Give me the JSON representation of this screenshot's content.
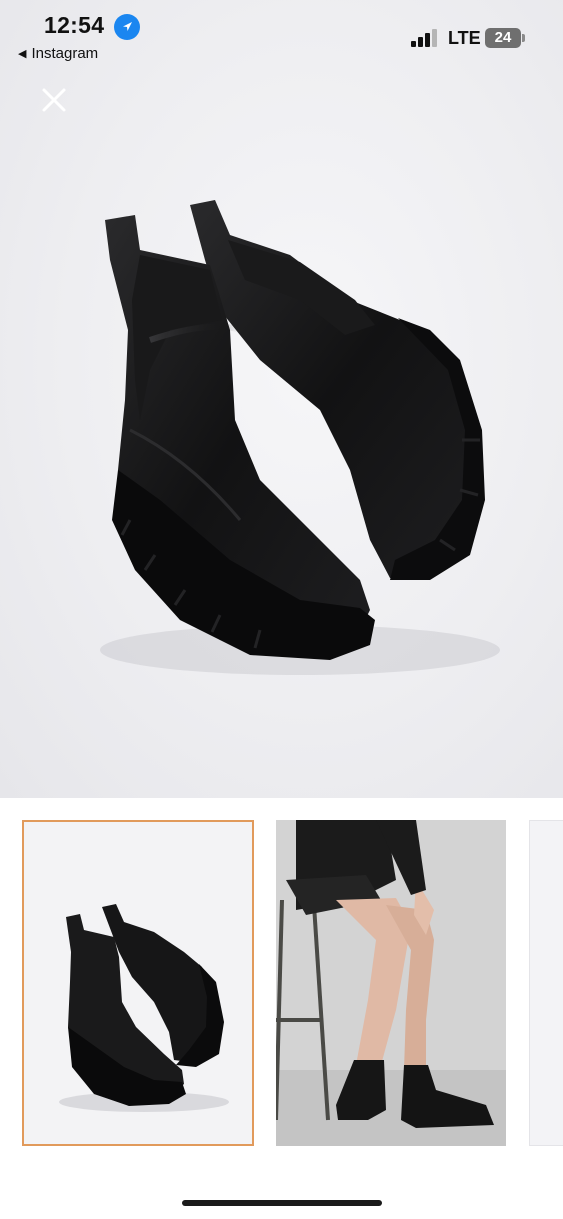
{
  "status_bar": {
    "time": "12:54",
    "back_label": "Instagram",
    "network": "LTE",
    "battery": "24",
    "location_icon": "location-arrow-icon",
    "signal_icon": "cellular-signal-icon"
  },
  "viewer": {
    "close_icon": "close-icon",
    "hero_image": "black-chelsea-boots-product-photo"
  },
  "thumbnails": [
    {
      "image": "black-chelsea-boots-thumbnail",
      "selected": true
    },
    {
      "image": "model-wearing-boots-on-stool-thumbnail",
      "selected": false
    },
    {
      "image": "partial-thumbnail",
      "selected": false
    }
  ],
  "colors": {
    "selected_border": "#e19a5b",
    "location_blue": "#1a86f0"
  }
}
